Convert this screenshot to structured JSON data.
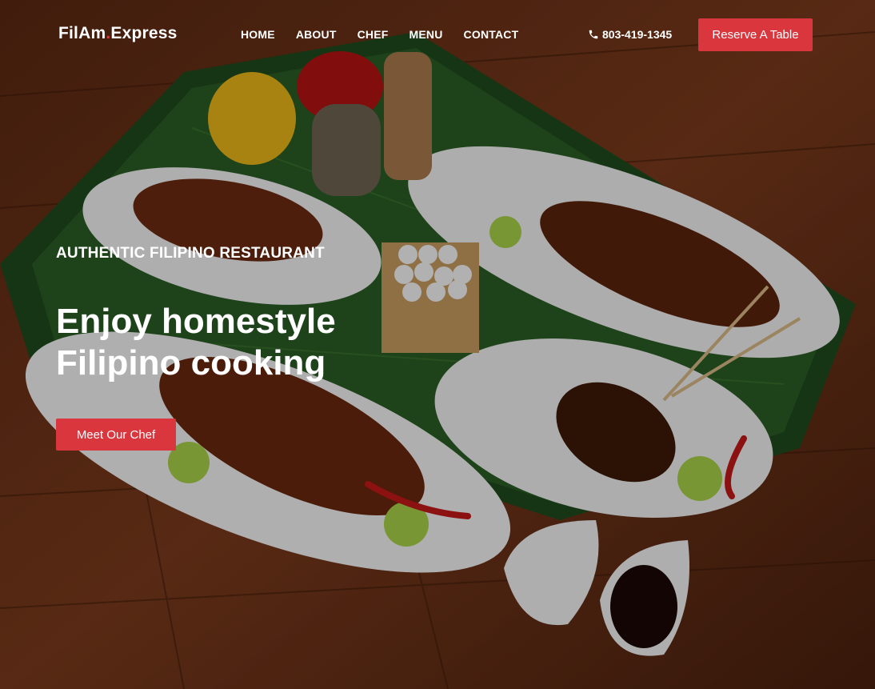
{
  "brand": {
    "name_left": "FilAm",
    "name_dot": ".",
    "name_right": "Express",
    "accent": "#d9363e"
  },
  "nav": {
    "items": [
      "HOME",
      "ABOUT",
      "CHEF",
      "MENU",
      "CONTACT"
    ]
  },
  "contact": {
    "phone": "803-419-1345",
    "phone_icon": "phone-icon"
  },
  "header": {
    "reserve_label": "Reserve A Table"
  },
  "hero": {
    "eyebrow": "AUTHENTIC FILIPINO RESTAURANT",
    "headline_line1": "Enjoy homestyle",
    "headline_line2": "Filipino cooking",
    "cta_label": "Meet Our Chef",
    "image": "filipino-food-platters-on-banana-leaves"
  }
}
